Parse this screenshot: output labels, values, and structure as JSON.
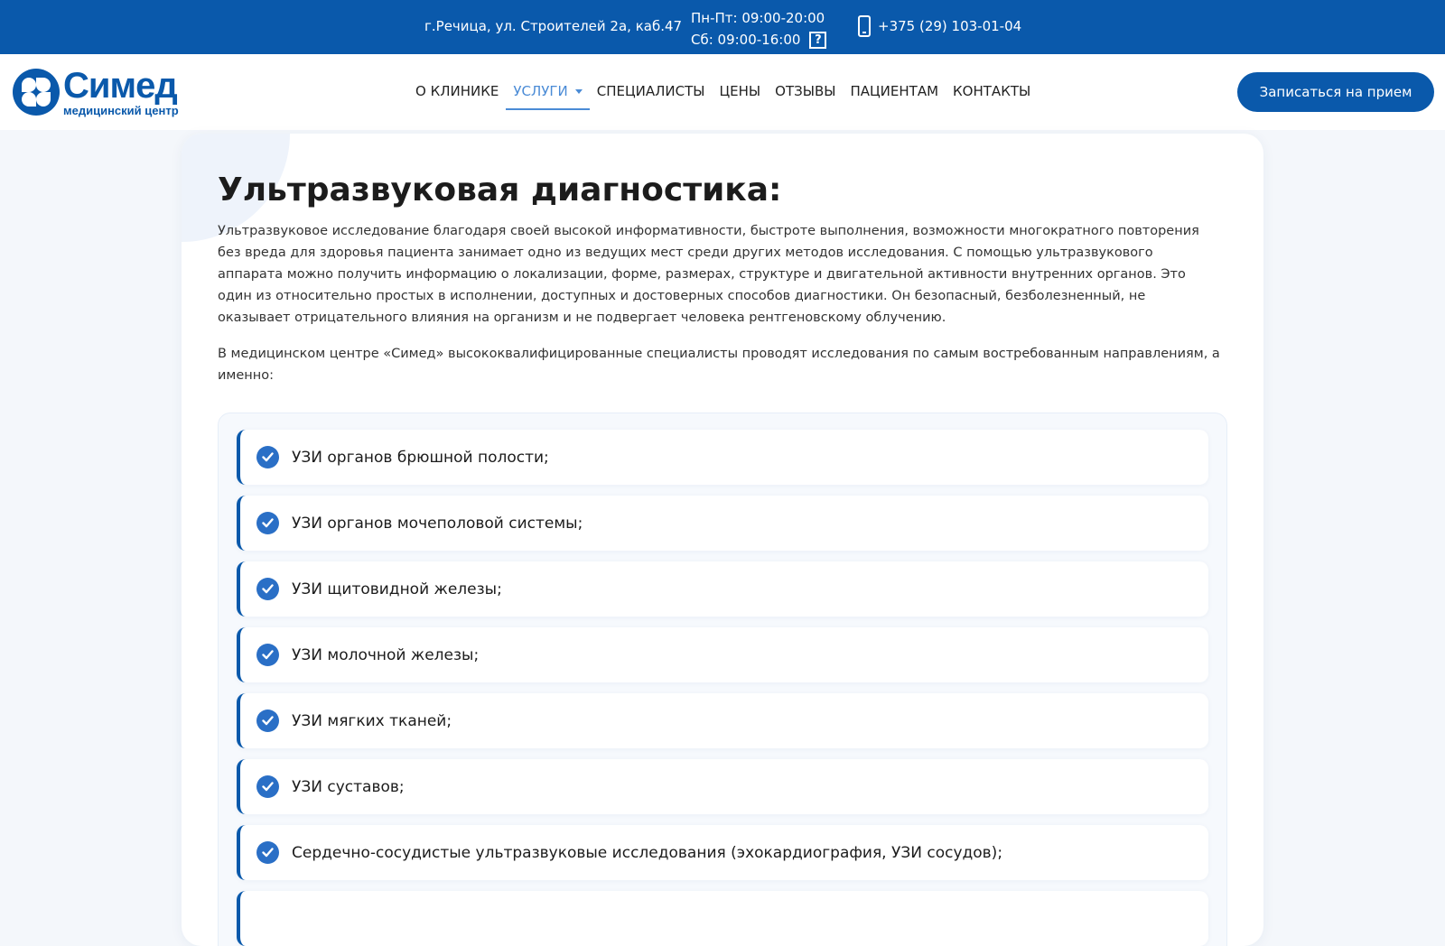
{
  "topbar": {
    "address": "г.Речица, ул. Строителей 2а, каб.47",
    "hours_weekdays": "Пн-Пт: 09:00-20:00",
    "hours_saturday": "Сб: 09:00-16:00",
    "help_symbol": "?",
    "phone": "+375 (29) 103-01-04",
    "phone_icon": "mobile-phone-icon"
  },
  "header": {
    "logo_name": "Симед",
    "logo_subtitle": "медицинский центр",
    "nav": {
      "about": "О КЛИНИКЕ",
      "services": "УСЛУГИ",
      "specialists": "СПЕЦИАЛИСТЫ",
      "prices": "ЦЕНЫ",
      "reviews": "ОТЗЫВЫ",
      "patients": "ПАЦИЕНТАМ",
      "contacts": "КОНТАКТЫ"
    },
    "active_nav": "services",
    "cta": "Записаться на прием"
  },
  "content": {
    "title": "Ультразвуковая диагностика:",
    "intro": "Ультразвуковое исследование благодаря своей высокой информативности, быстроте выполнения, возможности многократного повторения без вреда для здоровья пациента занимает одно из ведущих мест среди других методов исследования. С помощью ультразвукового аппарата можно получить информацию о локализации, форме, размерах, структуре и двигательной активности внутренних органов. Это один из относительно простых в исполнении, доступных и достоверных способов диагностики. Он безопасный, безболезненный, не оказывает отрицательного влияния на организм и не подвергает человека рентгеновскому облучению.",
    "intro2": "В медицинском центре «Симед» высококвалифицированные специалисты проводят исследования по самым востребованным направлениям, а именно:",
    "items": [
      "УЗИ органов брюшной полости;",
      "УЗИ органов мочеполовой системы;",
      "УЗИ щитовидной железы;",
      "УЗИ молочной железы;",
      "УЗИ мягких тканей;",
      "УЗИ суставов;",
      "Сердечно-сосудистые ультразвуковые исследования (эхокардиография, УЗИ сосудов);"
    ]
  },
  "colors": {
    "brand_blue": "#0a59ab",
    "active_nav": "#4a8bd6",
    "check_blue": "#2a6fc6"
  }
}
